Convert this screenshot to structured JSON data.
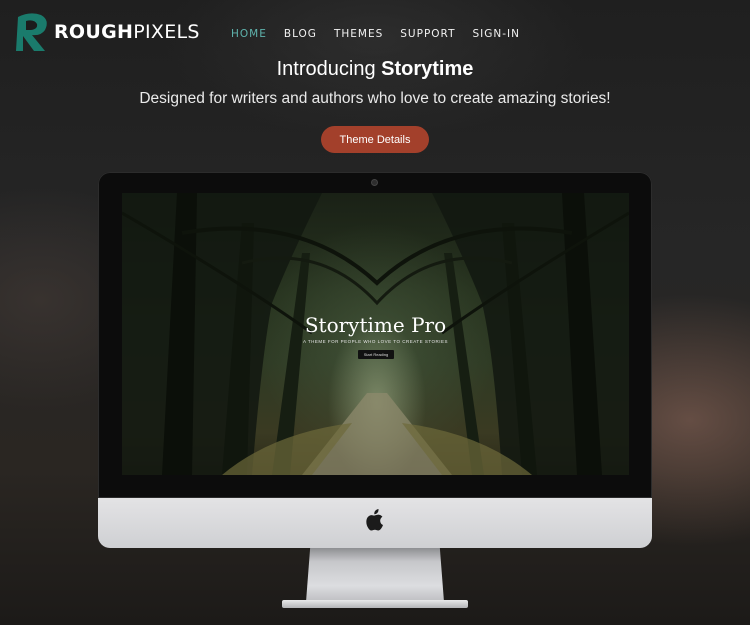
{
  "brand": {
    "name_bold": "ROUGH",
    "name_regular": "PIXELS",
    "logo_color": "#1a7b6c"
  },
  "nav": {
    "items": [
      "HOME",
      "BLOG",
      "THEMES",
      "SUPPORT",
      "SIGN-IN"
    ],
    "active_color": "#5fb3ad"
  },
  "hero": {
    "title_prefix": "Introducing ",
    "title_bold": "Storytime",
    "subtitle": "Designed for writers and authors who love to create amazing stories!",
    "button_label": "Theme Details",
    "button_color": "#a3402b"
  },
  "screen": {
    "title": "Storytime Pro",
    "tagline": "A THEME FOR PEOPLE WHO LOVE TO CREATE STORIES",
    "button_label": "Start Reading"
  },
  "device": {
    "logo_icon": "apple-icon"
  }
}
